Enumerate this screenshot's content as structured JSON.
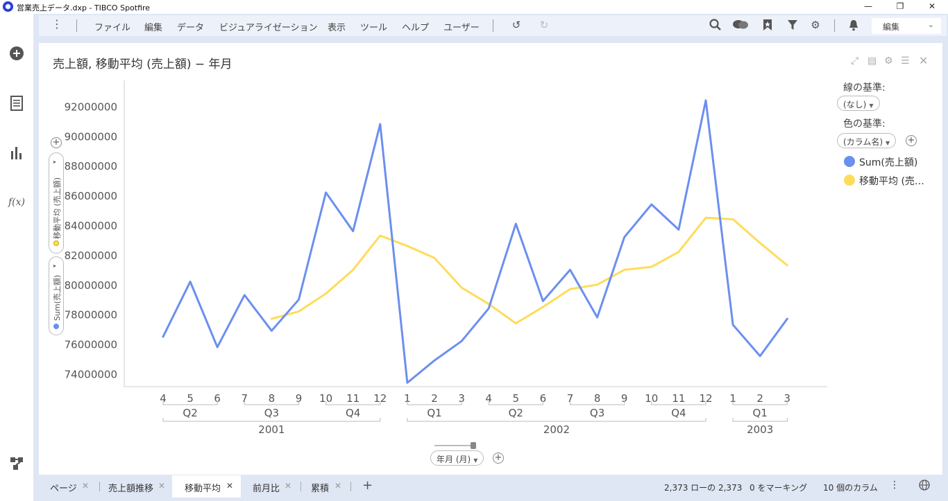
{
  "window": {
    "title": "営業売上データ.dxp - TIBCO Spotfire"
  },
  "menu": {
    "items": [
      "ファイル",
      "編集",
      "データ",
      "ビジュアライゼーション",
      "表示",
      "ツール",
      "ヘルプ",
      "ユーザー"
    ],
    "edit_mode": "編集"
  },
  "viz": {
    "title": "売上額, 移動平均 (売上額) − 年月",
    "line_by_label": "線の基準:",
    "line_by_value": "(なし)",
    "color_by_label": "色の基準:",
    "color_by_value": "(カラム名)",
    "legend": [
      {
        "label": "Sum(売上額)",
        "color": "#6b8ff0"
      },
      {
        "label": "移動平均 (売…",
        "color": "#fedc5a"
      }
    ],
    "yaxis_pills": [
      "移動平均 (売上額)",
      "Sum(売上額)"
    ],
    "xaxis_pill": "年月 (月)"
  },
  "chart_data": {
    "type": "line",
    "title": "売上額, 移動平均 (売上額) − 年月",
    "x_months": [
      "4",
      "5",
      "6",
      "7",
      "8",
      "9",
      "10",
      "11",
      "12",
      "1",
      "2",
      "3",
      "4",
      "5",
      "6",
      "7",
      "8",
      "9",
      "10",
      "11",
      "12",
      "1",
      "2",
      "3"
    ],
    "quarter_labels": [
      {
        "label": "Q2",
        "from": 0,
        "to": 2
      },
      {
        "label": "Q3",
        "from": 3,
        "to": 5
      },
      {
        "label": "Q4",
        "from": 6,
        "to": 8
      },
      {
        "label": "Q1",
        "from": 9,
        "to": 11
      },
      {
        "label": "Q2",
        "from": 12,
        "to": 14
      },
      {
        "label": "Q3",
        "from": 15,
        "to": 17
      },
      {
        "label": "Q4",
        "from": 18,
        "to": 20
      },
      {
        "label": "Q1",
        "from": 21,
        "to": 23
      }
    ],
    "year_labels": [
      {
        "label": "2001",
        "from": 0,
        "to": 8
      },
      {
        "label": "2002",
        "from": 9,
        "to": 20
      },
      {
        "label": "2003",
        "from": 21,
        "to": 23
      }
    ],
    "y_ticks": [
      74000000,
      76000000,
      78000000,
      80000000,
      82000000,
      84000000,
      86000000,
      88000000,
      90000000,
      92000000
    ],
    "y_tick_labels": [
      "74000000",
      "76000000",
      "78000000",
      "80000000",
      "82000000",
      "84000000",
      "86000000",
      "88000000",
      "90000000",
      "92000000"
    ],
    "ylim": [
      72600000,
      93000000
    ],
    "series": [
      {
        "name": "Sum(売上額)",
        "color": "#6b8ff0",
        "values": [
          76500000,
          80200000,
          75800000,
          79300000,
          76900000,
          79000000,
          86200000,
          83600000,
          90800000,
          73400000,
          74900000,
          76200000,
          78400000,
          84100000,
          78900000,
          81000000,
          77800000,
          83200000,
          85400000,
          83700000,
          92400000,
          77300000,
          75200000,
          77700000
        ]
      },
      {
        "name": "移動平均 (売上額)",
        "color": "#fedc5a",
        "values": [
          null,
          null,
          null,
          null,
          77700000,
          78200000,
          79400000,
          81000000,
          83300000,
          82600000,
          81800000,
          79800000,
          78700000,
          77400000,
          78500000,
          79700000,
          80000000,
          81000000,
          81200000,
          82200000,
          84500000,
          84400000,
          82800000,
          81300000
        ]
      }
    ]
  },
  "tabs": [
    {
      "label": "ページ",
      "active": false
    },
    {
      "label": "売上額推移",
      "active": false
    },
    {
      "label": "移動平均",
      "active": true
    },
    {
      "label": "前月比",
      "active": false
    },
    {
      "label": "累積",
      "active": false
    }
  ],
  "status": {
    "rows": "2,373 ローの 2,373",
    "marked": "0 をマーキング",
    "columns": "10 個のカラム"
  }
}
